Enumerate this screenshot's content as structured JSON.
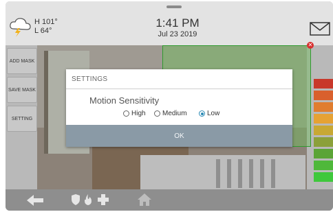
{
  "header": {
    "temp_high": "H 101°",
    "temp_low": "L 64°",
    "time": "1:41 PM",
    "date": "Jul 23 2019",
    "weather_icon": "cloud-lightning-icon",
    "mail_icon": "mail-icon"
  },
  "sidebar": {
    "items": [
      {
        "label": "ADD MASK"
      },
      {
        "label": "SAVE MASK"
      },
      {
        "label": "SETTING"
      }
    ]
  },
  "dialog": {
    "title": "SETTINGS",
    "label": "Motion Sensitivity",
    "options": [
      "High",
      "Medium",
      "Low"
    ],
    "selected": "Low",
    "ok_label": "OK"
  },
  "camera": {
    "mask_color": "#2f9a2f",
    "mask_close_icon": "close-icon"
  },
  "motion_levels": {
    "colors": [
      "#c8382a",
      "#d9602d",
      "#e07d2f",
      "#e6a234",
      "#c8a834",
      "#8ba03a",
      "#5ba436",
      "#4fb83a",
      "#3fc83c"
    ]
  },
  "bottom_nav": {
    "items": [
      "back-arrow-icon",
      "shield-icon",
      "fire-icon",
      "medical-cross-icon",
      "home-icon"
    ]
  }
}
